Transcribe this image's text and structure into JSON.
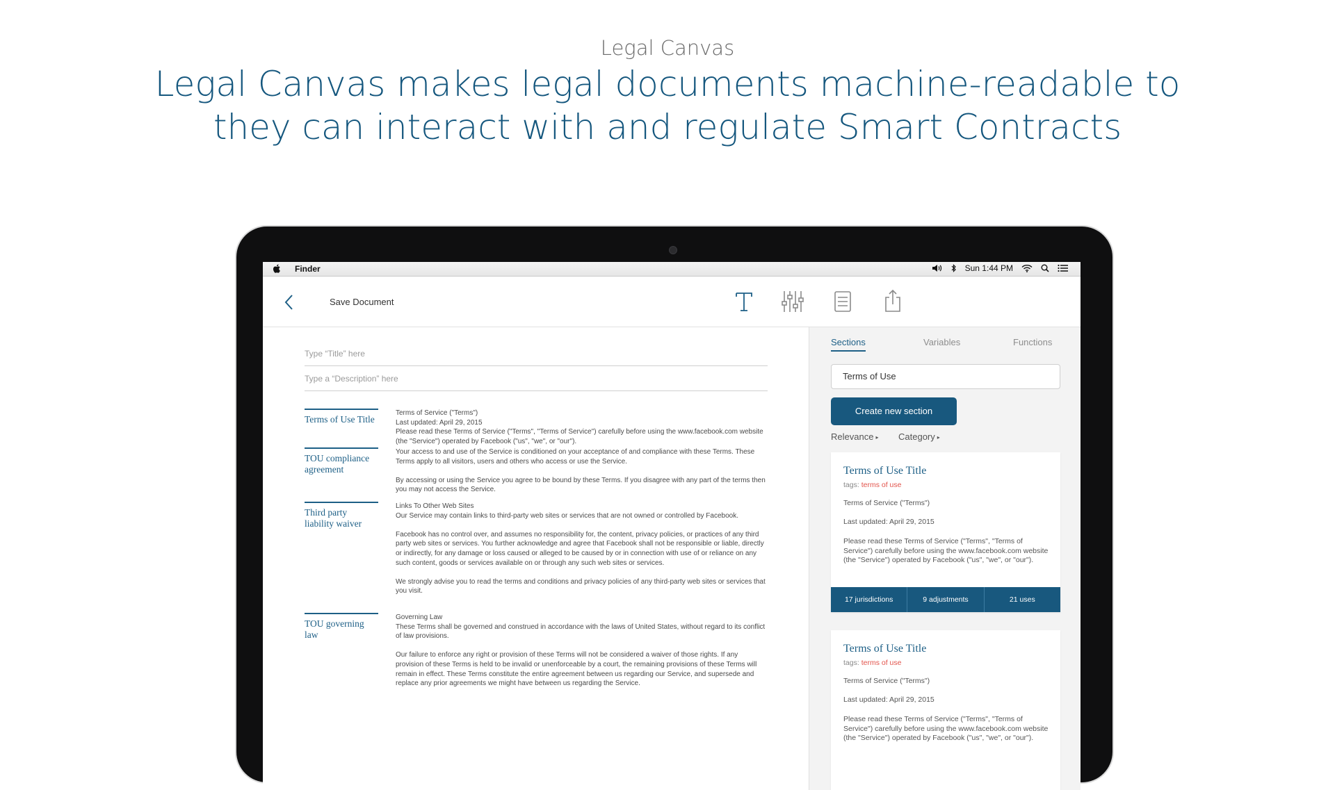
{
  "hero": {
    "eyebrow": "Legal Canvas",
    "headline": "Legal Canvas makes legal documents machine-readable to they can interact with and regulate Smart Contracts"
  },
  "menubar": {
    "app_name": "Finder",
    "clock": "Sun 1:44 PM"
  },
  "toolbar": {
    "save_label": "Save Document",
    "tools": [
      "text-format-icon",
      "sliders-icon",
      "document-list-icon",
      "share-icon"
    ]
  },
  "editor": {
    "title_placeholder": "Type “Title” here",
    "description_placeholder": "Type a “Description” here",
    "sections": [
      {
        "label": "Terms of Use Title",
        "paragraphs": [
          "Terms of Service (\"Terms\")\nLast updated: April 29, 2015\nPlease read these Terms of Service (\"Terms\", \"Terms of Service\") carefully before using the www.facebook.com website (the \"Service\") operated by Facebook (\"us\", \"we\", or \"our\")."
        ]
      },
      {
        "label": "TOU compliance agreement",
        "paragraphs": [
          "Your access to and use of the Service is conditioned on your acceptance of and compliance with these Terms. These Terms apply to all visitors, users and others who access or use the Service.",
          "By accessing or using the Service you agree to be bound by these Terms. If you disagree with any part of the terms then you may not access the Service."
        ]
      },
      {
        "label": "Third party liability waiver",
        "paragraphs": [
          "Links To Other Web Sites\nOur Service may contain links to third-party web sites or services that are not owned or controlled by Facebook.",
          "Facebook has no control over, and assumes no responsibility for, the content, privacy policies, or practices of any third party web sites or services. You further acknowledge and agree that Facebook shall not be responsible or liable, directly or indirectly, for any damage or loss caused or alleged to be caused by or in connection with use of or reliance on any such content, goods or services available on or through any such web sites or services.",
          "We strongly advise you to read the terms and conditions and privacy policies of any third-party web sites or services that you visit."
        ]
      },
      {
        "label": "TOU governing law",
        "paragraphs": [
          "Governing Law\nThese Terms shall be governed and construed in accordance with the laws of United States, without regard to its conflict of law provisions.",
          "Our failure to enforce any right or provision of these Terms will not be considered a waiver of those rights. If any provision of these Terms is held to be invalid or unenforceable by a court, the remaining provisions of these Terms will remain in effect. These Terms constitute the entire agreement between us regarding our Service, and supersede and replace any prior agreements we might have between us regarding the Service."
        ]
      }
    ]
  },
  "sidebar": {
    "tabs": [
      {
        "label": "Sections",
        "active": true
      },
      {
        "label": "Variables",
        "active": false
      },
      {
        "label": "Functions",
        "active": false
      }
    ],
    "search_value": "Terms of Use",
    "create_label": "Create new section",
    "sort_relevance": "Relevance",
    "sort_category": "Category",
    "cards": [
      {
        "title": "Terms of Use Title",
        "tags_prefix": "tags:",
        "tag": "terms of use",
        "line1": "Terms of Service (\"Terms\")",
        "line2": "Last updated: April 29, 2015",
        "line3": "Please read these Terms of Service (\"Terms\", \"Terms of Service\") carefully before using the www.facebook.com website (the \"Service\") operated by Facebook (\"us\", \"we\", or \"our\").",
        "stats": [
          "17 jurisdictions",
          "9 adjustments",
          "21 uses"
        ]
      },
      {
        "title": "Terms of Use Title",
        "tags_prefix": "tags:",
        "tag": "terms of use",
        "line1": "Terms of Service (\"Terms\")",
        "line2": "Last updated: April 29, 2015",
        "line3": "Please read these Terms of Service (\"Terms\", \"Terms of Service\") carefully before using the www.facebook.com website (the \"Service\") operated by Facebook (\"us\", \"we\", or \"our\")."
      }
    ]
  },
  "colors": {
    "brand": "#15577e",
    "button": "#18587e",
    "tag": "#e2534b"
  }
}
